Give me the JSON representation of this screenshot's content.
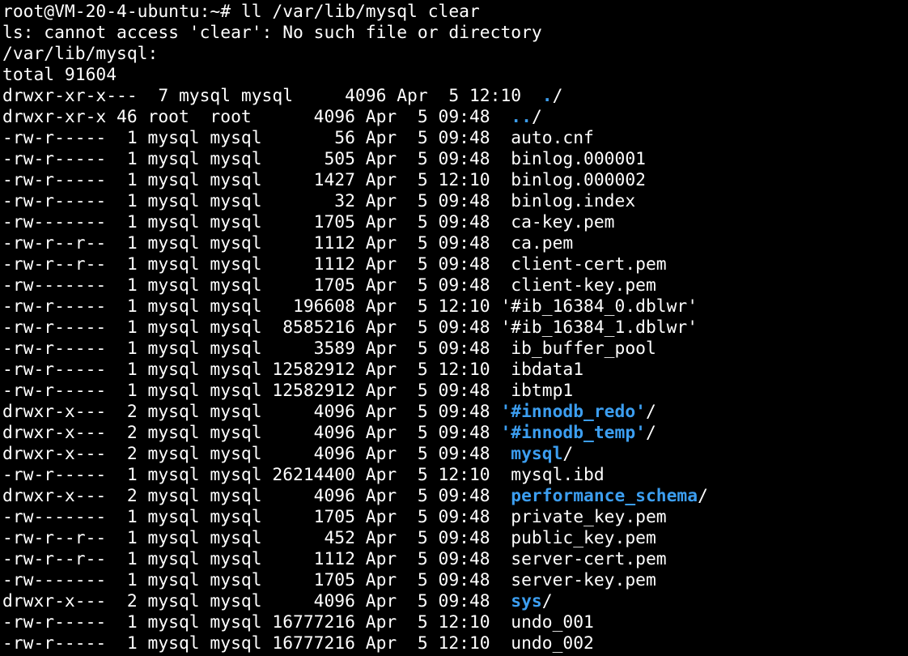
{
  "terminal": {
    "prompt": "root@VM-20-4-ubuntu:~# ll /var/lib/mysql clear",
    "error": "ls: cannot access 'clear': No such file or directory",
    "dir_header": "/var/lib/mysql:",
    "total": "total 91604",
    "colors": {
      "background": "#000000",
      "foreground": "#ffffff",
      "directory": "#3c9ef0",
      "cursor": "#1fb33a"
    },
    "entries": [
      {
        "meta": "drwxr-xr-x---  7 mysql mysql     4096 Apr  5 12:10 ",
        "q1": " ",
        "name": ".",
        "q2": "",
        "suffix": "/",
        "is_dir": true
      },
      {
        "meta": "drwxr-xr-x 46 root  root      4096 Apr  5 09:48 ",
        "q1": " ",
        "name": "..",
        "q2": "",
        "suffix": "/",
        "is_dir": true
      },
      {
        "meta": "-rw-r-----  1 mysql mysql       56 Apr  5 09:48 ",
        "q1": " ",
        "name": "auto.cnf",
        "q2": "",
        "suffix": "",
        "is_dir": false
      },
      {
        "meta": "-rw-r-----  1 mysql mysql      505 Apr  5 09:48 ",
        "q1": " ",
        "name": "binlog.000001",
        "q2": "",
        "suffix": "",
        "is_dir": false
      },
      {
        "meta": "-rw-r-----  1 mysql mysql     1427 Apr  5 12:10 ",
        "q1": " ",
        "name": "binlog.000002",
        "q2": "",
        "suffix": "",
        "is_dir": false
      },
      {
        "meta": "-rw-r-----  1 mysql mysql       32 Apr  5 09:48 ",
        "q1": " ",
        "name": "binlog.index",
        "q2": "",
        "suffix": "",
        "is_dir": false
      },
      {
        "meta": "-rw-------  1 mysql mysql     1705 Apr  5 09:48 ",
        "q1": " ",
        "name": "ca-key.pem",
        "q2": "",
        "suffix": "",
        "is_dir": false
      },
      {
        "meta": "-rw-r--r--  1 mysql mysql     1112 Apr  5 09:48 ",
        "q1": " ",
        "name": "ca.pem",
        "q2": "",
        "suffix": "",
        "is_dir": false
      },
      {
        "meta": "-rw-r--r--  1 mysql mysql     1112 Apr  5 09:48 ",
        "q1": " ",
        "name": "client-cert.pem",
        "q2": "",
        "suffix": "",
        "is_dir": false
      },
      {
        "meta": "-rw-------  1 mysql mysql     1705 Apr  5 09:48 ",
        "q1": " ",
        "name": "client-key.pem",
        "q2": "",
        "suffix": "",
        "is_dir": false
      },
      {
        "meta": "-rw-r-----  1 mysql mysql   196608 Apr  5 12:10 ",
        "q1": "'",
        "name": "#ib_16384_0.dblwr",
        "q2": "'",
        "suffix": "",
        "is_dir": false
      },
      {
        "meta": "-rw-r-----  1 mysql mysql  8585216 Apr  5 09:48 ",
        "q1": "'",
        "name": "#ib_16384_1.dblwr",
        "q2": "'",
        "suffix": "",
        "is_dir": false
      },
      {
        "meta": "-rw-r-----  1 mysql mysql     3589 Apr  5 09:48 ",
        "q1": " ",
        "name": "ib_buffer_pool",
        "q2": "",
        "suffix": "",
        "is_dir": false
      },
      {
        "meta": "-rw-r-----  1 mysql mysql 12582912 Apr  5 12:10 ",
        "q1": " ",
        "name": "ibdata1",
        "q2": "",
        "suffix": "",
        "is_dir": false
      },
      {
        "meta": "-rw-r-----  1 mysql mysql 12582912 Apr  5 09:48 ",
        "q1": " ",
        "name": "ibtmp1",
        "q2": "",
        "suffix": "",
        "is_dir": false
      },
      {
        "meta": "drwxr-x---  2 mysql mysql     4096 Apr  5 09:48 ",
        "q1": "'",
        "name": "#innodb_redo",
        "q2": "'",
        "suffix": "/",
        "is_dir": true
      },
      {
        "meta": "drwxr-x---  2 mysql mysql     4096 Apr  5 09:48 ",
        "q1": "'",
        "name": "#innodb_temp",
        "q2": "'",
        "suffix": "/",
        "is_dir": true
      },
      {
        "meta": "drwxr-x---  2 mysql mysql     4096 Apr  5 09:48 ",
        "q1": " ",
        "name": "mysql",
        "q2": "",
        "suffix": "/",
        "is_dir": true
      },
      {
        "meta": "-rw-r-----  1 mysql mysql 26214400 Apr  5 12:10 ",
        "q1": " ",
        "name": "mysql.ibd",
        "q2": "",
        "suffix": "",
        "is_dir": false
      },
      {
        "meta": "drwxr-x---  2 mysql mysql     4096 Apr  5 09:48 ",
        "q1": " ",
        "name": "performance_schema",
        "q2": "",
        "suffix": "/",
        "is_dir": true
      },
      {
        "meta": "-rw-------  1 mysql mysql     1705 Apr  5 09:48 ",
        "q1": " ",
        "name": "private_key.pem",
        "q2": "",
        "suffix": "",
        "is_dir": false
      },
      {
        "meta": "-rw-r--r--  1 mysql mysql      452 Apr  5 09:48 ",
        "q1": " ",
        "name": "public_key.pem",
        "q2": "",
        "suffix": "",
        "is_dir": false
      },
      {
        "meta": "-rw-r--r--  1 mysql mysql     1112 Apr  5 09:48 ",
        "q1": " ",
        "name": "server-cert.pem",
        "q2": "",
        "suffix": "",
        "is_dir": false
      },
      {
        "meta": "-rw-------  1 mysql mysql     1705 Apr  5 09:48 ",
        "q1": " ",
        "name": "server-key.pem",
        "q2": "",
        "suffix": "",
        "is_dir": false
      },
      {
        "meta": "drwxr-x---  2 mysql mysql     4096 Apr  5 09:48 ",
        "q1": " ",
        "name": "sys",
        "q2": "",
        "suffix": "/",
        "is_dir": true
      },
      {
        "meta": "-rw-r-----  1 mysql mysql 16777216 Apr  5 12:10 ",
        "q1": " ",
        "name": "undo_001",
        "q2": "",
        "suffix": "",
        "is_dir": false
      },
      {
        "meta": "-rw-r-----  1 mysql mysql 16777216 Apr  5 12:10 ",
        "q1": " ",
        "name": "undo_002",
        "q2": "",
        "suffix": "",
        "is_dir": false
      }
    ]
  }
}
